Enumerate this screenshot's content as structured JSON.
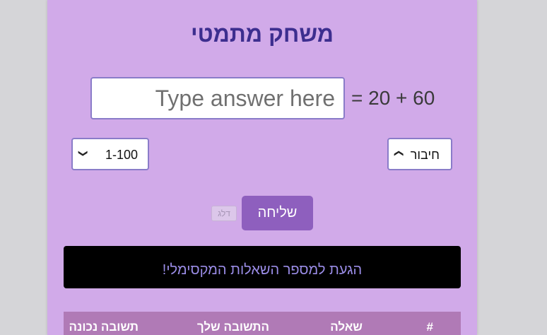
{
  "game": {
    "title": "משחק מתמטי",
    "answer_placeholder": "Type answer here",
    "equation": "= 20 + 60"
  },
  "selects": {
    "range_value": "1-100",
    "operation_value": "חיבור"
  },
  "buttons": {
    "send_label": "שליחה",
    "skip_label": "דלג"
  },
  "message": {
    "text": "הגעת למספר השאלות המקסימלי!"
  },
  "table": {
    "headers": [
      "#",
      "שאלה",
      "התשובה שלך",
      "תשובה נכונה"
    ]
  },
  "colors": {
    "panel_bg": "#d1aae9",
    "title": "#3d2e8f",
    "button": "#8e5fbe",
    "message_text": "#9a8ce6",
    "table_header_bg": "#b07ab6"
  },
  "icons": {
    "select_chevron": "chevron-down-icon"
  }
}
